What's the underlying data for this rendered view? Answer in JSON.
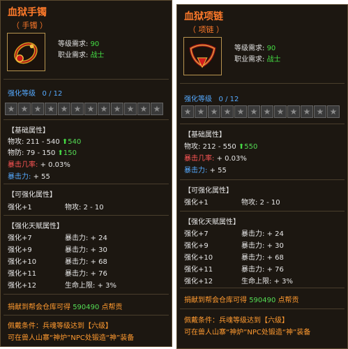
{
  "panels": [
    {
      "title": "血狱手镯",
      "subtitle": "（ 手镯 ）",
      "icon": "bracelet-icon",
      "level_label": "等级需求:",
      "level_value": "90",
      "class_label": "职业需求:",
      "class_value": "战士",
      "enhance_label": "强化等级",
      "enhance_value": "0 / 12",
      "stars": 12,
      "base_title": "【基础属性】",
      "base": [
        {
          "label": "物攻:",
          "value": "211 - 540",
          "bonus": "540"
        },
        {
          "label": "物防:",
          "value": "79 - 150",
          "bonus": "150"
        },
        {
          "label": "暴击几率:",
          "value": "+ 0.03%"
        },
        {
          "label": "暴击力:",
          "value": "+ 55"
        }
      ],
      "enh_title": "【可强化属性】",
      "enh": {
        "label": "强化+1",
        "stat": "物攻:",
        "value": "2 - 10"
      },
      "talent_title": "【强化天赋属性】",
      "talents": [
        {
          "level": "强化+7",
          "stat": "暴击力:",
          "value": "+ 24"
        },
        {
          "level": "强化+9",
          "stat": "暴击力:",
          "value": "+ 30"
        },
        {
          "level": "强化+10",
          "stat": "暴击力:",
          "value": "+ 68"
        },
        {
          "level": "强化+11",
          "stat": "暴击力:",
          "value": "+ 76"
        },
        {
          "level": "强化+12",
          "stat": "生命上限:",
          "value": "+ 3%"
        }
      ],
      "donate_a": "捐献到帮会仓库可得",
      "donate_num": "590490",
      "donate_b": "点帮贡",
      "cond_line1": "佩戴条件：兵魂等级达到【六级】",
      "cond_line2": "可在兽人山寨“神炉”NPC处锻造“神”装备"
    },
    {
      "title": "血狱项链",
      "subtitle": "（ 项链 ）",
      "icon": "necklace-icon",
      "level_label": "等级需求:",
      "level_value": "90",
      "class_label": "职业需求:",
      "class_value": "战士",
      "enhance_label": "强化等级",
      "enhance_value": "0 / 12",
      "stars": 12,
      "base_title": "【基础属性】",
      "base": [
        {
          "label": "物攻:",
          "value": "212 - 550",
          "bonus": "550"
        },
        {
          "label": "暴击几率:",
          "value": "+ 0.03%"
        },
        {
          "label": "暴击力:",
          "value": "+ 55"
        }
      ],
      "enh_title": "【可强化属性】",
      "enh": {
        "label": "强化+1",
        "stat": "物攻:",
        "value": "2 - 10"
      },
      "talent_title": "【强化天赋属性】",
      "talents": [
        {
          "level": "强化+7",
          "stat": "暴击力:",
          "value": "+ 24"
        },
        {
          "level": "强化+9",
          "stat": "暴击力:",
          "value": "+ 30"
        },
        {
          "level": "强化+10",
          "stat": "暴击力:",
          "value": "+ 68"
        },
        {
          "level": "强化+11",
          "stat": "暴击力:",
          "value": "+ 76"
        },
        {
          "level": "强化+12",
          "stat": "生命上限:",
          "value": "+ 3%"
        }
      ],
      "donate_a": "捐献到帮会仓库可得",
      "donate_num": "590490",
      "donate_b": "点帮贡",
      "cond_line1": "佩戴条件：兵魂等级达到【六级】",
      "cond_line2": "可在兽人山寨“神炉”NPC处锻造“神”装备"
    }
  ],
  "colors": {
    "title": "#ff7a2a",
    "value_green": "#44dd44",
    "blue": "#55aaff",
    "red": "#ff5555"
  }
}
